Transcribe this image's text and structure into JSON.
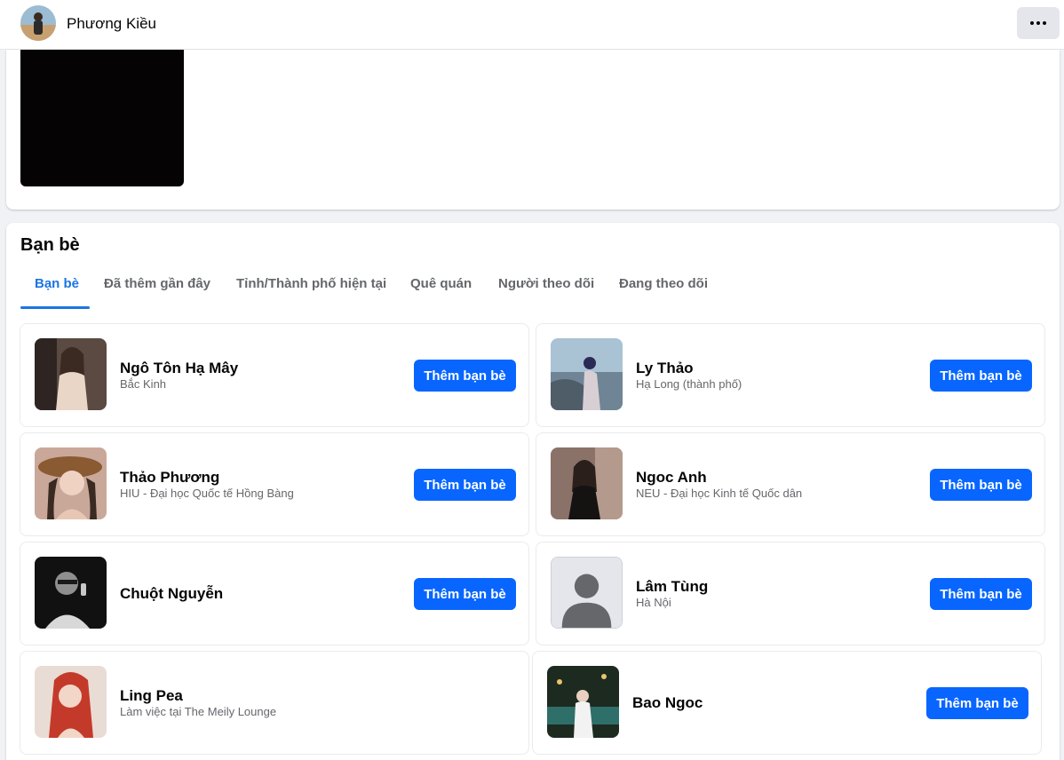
{
  "header": {
    "profile_name": "Phương Kiều",
    "more_icon": "more-horizontal-icon"
  },
  "friends_section": {
    "title": "Bạn bè",
    "tabs": [
      {
        "label": "Bạn bè",
        "active": true
      },
      {
        "label": "Đã thêm gần đây",
        "active": false
      },
      {
        "label": "Tỉnh/Thành phố hiện tại",
        "active": false
      },
      {
        "label": "Quê quán",
        "active": false
      },
      {
        "label": "Người theo dõi",
        "active": false
      },
      {
        "label": "Đang theo dõi",
        "active": false
      }
    ],
    "add_friend_label": "Thêm bạn bè",
    "friends": [
      {
        "name": "Ngô Tôn Hạ Mây",
        "subtitle": "Bắc Kinh"
      },
      {
        "name": "Ly Thảo",
        "subtitle": "Hạ Long (thành phố)"
      },
      {
        "name": "Thảo Phương",
        "subtitle": "HIU - Đại học Quốc tế Hồng Bàng"
      },
      {
        "name": "Ngoc Anh",
        "subtitle": "NEU - Đại học Kinh tế Quốc dân"
      },
      {
        "name": "Chuột Nguyễn",
        "subtitle": ""
      },
      {
        "name": "Lâm Tùng",
        "subtitle": "Hà Nội"
      },
      {
        "name": "Ling Pea",
        "subtitle": "Làm việc tại The Meily Lounge"
      },
      {
        "name": "Bao Ngoc",
        "subtitle": ""
      }
    ]
  },
  "colors": {
    "accent": "#1b74e4",
    "button": "#0866ff",
    "page_bg": "#f0f2f5"
  }
}
